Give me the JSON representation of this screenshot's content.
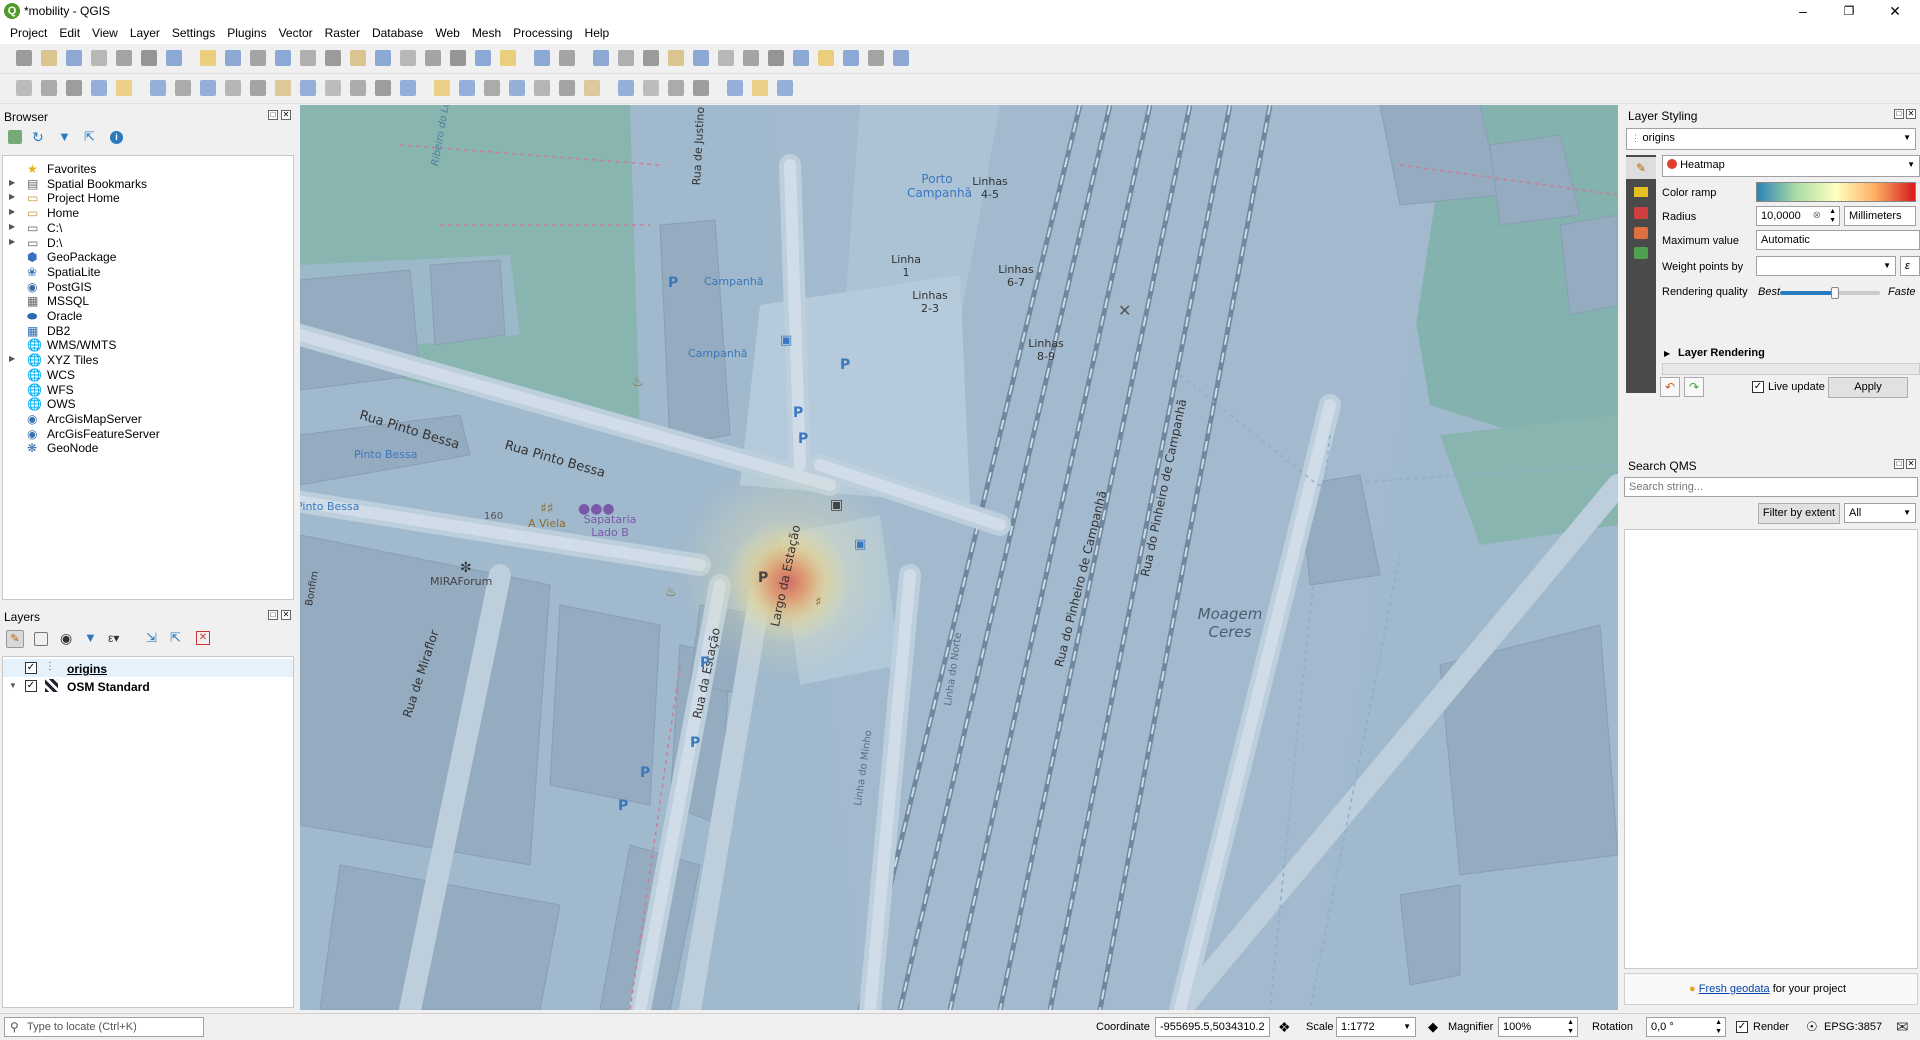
{
  "window": {
    "title": "*mobility - QGIS"
  },
  "menu": [
    "Project",
    "Edit",
    "View",
    "Layer",
    "Settings",
    "Plugins",
    "Vector",
    "Raster",
    "Database",
    "Web",
    "Mesh",
    "Processing",
    "Help"
  ],
  "browser": {
    "title": "Browser",
    "items": [
      {
        "label": "Favorites",
        "icon": "star-icon",
        "expandable": false
      },
      {
        "label": "Spatial Bookmarks",
        "icon": "bookmark-icon",
        "expandable": true
      },
      {
        "label": "Project Home",
        "icon": "folder-icon",
        "expandable": true
      },
      {
        "label": "Home",
        "icon": "folder-icon",
        "expandable": true
      },
      {
        "label": "C:\\",
        "icon": "drive-icon",
        "expandable": true
      },
      {
        "label": "D:\\",
        "icon": "drive-icon",
        "expandable": true
      },
      {
        "label": "GeoPackage",
        "icon": "geopackage-icon",
        "expandable": false
      },
      {
        "label": "SpatiaLite",
        "icon": "spatialite-icon",
        "expandable": false
      },
      {
        "label": "PostGIS",
        "icon": "postgis-icon",
        "expandable": false
      },
      {
        "label": "MSSQL",
        "icon": "mssql-icon",
        "expandable": false
      },
      {
        "label": "Oracle",
        "icon": "oracle-icon",
        "expandable": false
      },
      {
        "label": "DB2",
        "icon": "db2-icon",
        "expandable": false
      },
      {
        "label": "WMS/WMTS",
        "icon": "globe-icon",
        "expandable": false
      },
      {
        "label": "XYZ Tiles",
        "icon": "globe-icon",
        "expandable": true
      },
      {
        "label": "WCS",
        "icon": "globe-icon",
        "expandable": false
      },
      {
        "label": "WFS",
        "icon": "globe-icon",
        "expandable": false
      },
      {
        "label": "OWS",
        "icon": "globe-icon",
        "expandable": false
      },
      {
        "label": "ArcGisMapServer",
        "icon": "arcgis-icon",
        "expandable": false
      },
      {
        "label": "ArcGisFeatureServer",
        "icon": "arcgis-icon",
        "expandable": false
      },
      {
        "label": "GeoNode",
        "icon": "geonode-icon",
        "expandable": false
      }
    ]
  },
  "layers": {
    "title": "Layers",
    "items": [
      {
        "label": "origins",
        "checked": true
      },
      {
        "label": "OSM Standard",
        "checked": true
      }
    ]
  },
  "styling": {
    "title": "Layer Styling",
    "layer": "origins",
    "renderer": "Heatmap",
    "color_ramp_label": "Color ramp",
    "radius_label": "Radius",
    "radius_value": "10,0000",
    "radius_unit": "Millimeters",
    "max_label": "Maximum value",
    "max_value": "Automatic",
    "weight_label": "Weight points by",
    "weight_value": "",
    "quality_label": "Rendering quality",
    "quality_best": "Best",
    "quality_fast": "Faste",
    "quality_level": 0.55,
    "layer_rendering": "Layer Rendering",
    "live_update": "Live update",
    "apply": "Apply"
  },
  "qms": {
    "title": "Search QMS",
    "placeholder": "Search string...",
    "filter_btn": "Filter by extent",
    "filter_value": "All",
    "footer_link": "Fresh geodata",
    "footer_text": "for your project"
  },
  "status": {
    "locate_placeholder": "Type to locate (Ctrl+K)",
    "coordinate_label": "Coordinate",
    "coordinate": "-955695.5,5034310.2",
    "scale_label": "Scale",
    "scale": "1:1772",
    "magnifier_label": "Magnifier",
    "magnifier": "100%",
    "rotation_label": "Rotation",
    "rotation": "0,0 °",
    "render_label": "Render",
    "crs": "EPSG:3857"
  },
  "map_labels": {
    "rua_justino": "Rua de Justino Teix",
    "rua_pinto_bessa_1": "Rua Pinto Bessa",
    "rua_pinto_bessa_2": "Rua Pinto Bessa",
    "pinto_bessa_1": "Pinto Bessa",
    "pinto_bessa_2": "Pinto Bessa",
    "porto_campanha": "Porto Campanhã",
    "campanha_1": "Campanhã",
    "campanha_2": "Campanhã",
    "linhas_45": "Linhas 4-5",
    "linha_1": "Linha 1",
    "linhas_23": "Linhas 2-3",
    "linhas_67": "Linhas 6-7",
    "linhas_89": "Linhas 8-9",
    "a_viela": "A Viela",
    "sapataria": "Sapataria Lado B",
    "num_160": "160",
    "miraforum": "MIRAForum",
    "rua_da_estacao": "Rua da Estação",
    "largo_da_estacao": "Largo da Estação",
    "rua_de_miraflor": "Rua de Miraflor",
    "rua_pinheiro_1": "Rua do Pinheiro de Campanhã",
    "rua_pinheiro_2": "Rua do Pinheiro de Campanhã",
    "moagem": "Moagem Ceres",
    "linha_do_minho": "Linha do Minho",
    "linha_do_norte": "Linha do Norte",
    "bonfim": "Bonfim",
    "ribeiro": "Ribeiro do Lo"
  }
}
